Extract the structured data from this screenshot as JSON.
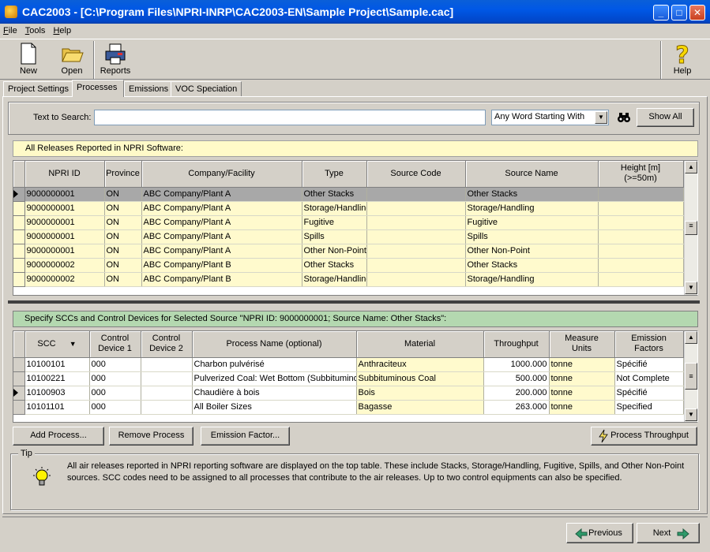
{
  "window": {
    "title": "CAC2003 - [C:\\Program Files\\NPRI-INRP\\CAC2003-EN\\Sample Project\\Sample.cac]"
  },
  "menu": [
    "File",
    "Tools",
    "Help"
  ],
  "toolbar": {
    "new": "New",
    "open": "Open",
    "reports": "Reports",
    "help": "Help"
  },
  "tabs": [
    "Project Settings",
    "Processes",
    "Emissions",
    "VOC Speciation"
  ],
  "search": {
    "label": "Text to Search:",
    "value": "",
    "mode": "Any Word Starting With",
    "show_all": "Show All"
  },
  "releases": {
    "header": "All Releases Reported in NPRI Software:",
    "columns": [
      "NPRI ID",
      "Province",
      "Company/Facility",
      "Type",
      "Source Code",
      "Source Name",
      "Height [m]\n(>=50m)"
    ],
    "rows": [
      [
        "9000000001",
        "ON",
        "ABC Company/Plant A",
        "Other Stacks",
        "",
        "Other Stacks",
        ""
      ],
      [
        "9000000001",
        "ON",
        "ABC Company/Plant A",
        "Storage/Handling",
        "",
        "Storage/Handling",
        ""
      ],
      [
        "9000000001",
        "ON",
        "ABC Company/Plant A",
        "Fugitive",
        "",
        "Fugitive",
        ""
      ],
      [
        "9000000001",
        "ON",
        "ABC Company/Plant A",
        "Spills",
        "",
        "Spills",
        ""
      ],
      [
        "9000000001",
        "ON",
        "ABC Company/Plant A",
        "Other Non-Point",
        "",
        "Other Non-Point",
        ""
      ],
      [
        "9000000002",
        "ON",
        "ABC Company/Plant B",
        "Other Stacks",
        "",
        "Other Stacks",
        ""
      ],
      [
        "9000000002",
        "ON",
        "ABC Company/Plant B",
        "Storage/Handling",
        "",
        "Storage/Handling",
        ""
      ]
    ]
  },
  "sccs": {
    "header": "Specify SCCs and Control Devices for Selected Source \"NPRI ID: 9000000001; Source Name: Other Stacks\":",
    "columns": [
      "SCC",
      "Control\nDevice 1",
      "Control\nDevice 2",
      "Process Name (optional)",
      "Material",
      "Throughput",
      "Measure\nUnits",
      "Emission\nFactors"
    ],
    "rows": [
      [
        "10100101",
        "000",
        "",
        "Charbon pulvérisé",
        "Anthraciteux",
        "1000.000",
        "tonne",
        "Spécifié"
      ],
      [
        "10100221",
        "000",
        "",
        "Pulverized Coal: Wet Bottom (Subbitumino",
        "Subbituminous Coal",
        "500.000",
        "tonne",
        "Not Complete"
      ],
      [
        "10100903",
        "000",
        "",
        "Chaudière à bois",
        "Bois",
        "200.000",
        "tonne",
        "Spécifié"
      ],
      [
        "10101101",
        "000",
        "",
        "All Boiler Sizes",
        "Bagasse",
        "263.000",
        "tonne",
        "Specified"
      ]
    ]
  },
  "actions": {
    "add_process": "Add Process...",
    "remove_process": "Remove Process",
    "emission_factor": "Emission Factor...",
    "process_throughput": "Process Throughput"
  },
  "tip": {
    "label": "Tip",
    "text": "All air releases reported in NPRI reporting software are displayed on the top table.  These include Stacks, Storage/Handling, Fugitive, Spills, and Other Non-Point sources.  SCC codes need to be assigned to all processes that contribute to the air releases.  Up to two control equipments can also be specified."
  },
  "nav": {
    "previous": "Previous",
    "next": "Next"
  }
}
